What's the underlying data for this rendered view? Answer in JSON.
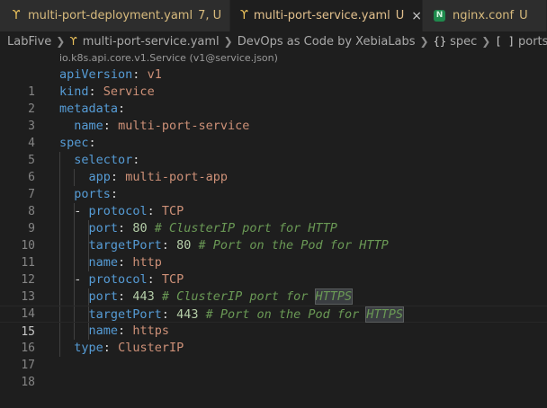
{
  "tabs": [
    {
      "label": "multi-port-deployment.yaml",
      "badge": "7, U",
      "icon": "yaml-icon",
      "active": false
    },
    {
      "label": "multi-port-service.yaml",
      "badge": "U",
      "icon": "yaml-icon",
      "active": true,
      "close": "×"
    },
    {
      "label": "nginx.conf",
      "badge": "U",
      "icon": "nginx-icon",
      "icon_text": "N",
      "active": false
    }
  ],
  "breadcrumb": {
    "folder": "LabFive",
    "file": "multi-port-service.yaml",
    "schema": "DevOps as Code by XebiaLabs",
    "spec_symbol": "{}",
    "spec": "spec",
    "ports_symbol": "[ ]",
    "ports": "ports"
  },
  "codelens": "io.k8s.api.core.v1.Service (v1@service.json)",
  "editor": {
    "current_line": 15,
    "lines": [
      {
        "n": "1"
      },
      {
        "n": "2"
      },
      {
        "n": "3"
      },
      {
        "n": "4"
      },
      {
        "n": "5"
      },
      {
        "n": "6"
      },
      {
        "n": "7"
      },
      {
        "n": "8"
      },
      {
        "n": "9"
      },
      {
        "n": "10"
      },
      {
        "n": "11"
      },
      {
        "n": "12"
      },
      {
        "n": "13"
      },
      {
        "n": "14"
      },
      {
        "n": "15"
      },
      {
        "n": "16"
      },
      {
        "n": "17"
      },
      {
        "n": "18"
      }
    ],
    "tokens": {
      "l1_key": "apiVersion",
      "l1_colon": ":",
      "l1_val": "v1",
      "l2_key": "kind",
      "l2_colon": ":",
      "l2_val": "Service",
      "l3_key": "metadata",
      "l3_colon": ":",
      "l4_key": "name",
      "l4_colon": ":",
      "l4_val": "multi-port-service",
      "l5_key": "spec",
      "l5_colon": ":",
      "l6_key": "selector",
      "l6_colon": ":",
      "l7_key": "app",
      "l7_colon": ":",
      "l7_val": "multi-port-app",
      "l8_key": "ports",
      "l8_colon": ":",
      "l9_dash": "-",
      "l9_key": "protocol",
      "l9_colon": ":",
      "l9_val": "TCP",
      "l10_key": "port",
      "l10_colon": ":",
      "l10_val": "80",
      "l10_comment": "# ClusterIP port for HTTP",
      "l11_key": "targetPort",
      "l11_colon": ":",
      "l11_val": "80",
      "l11_comment": "# Port on the Pod for HTTP",
      "l12_key": "name",
      "l12_colon": ":",
      "l12_val": "http",
      "l13_dash": "-",
      "l13_key": "protocol",
      "l13_colon": ":",
      "l13_val": "TCP",
      "l14_key": "port",
      "l14_colon": ":",
      "l14_val": "443",
      "l14_comment": "# ClusterIP port for ",
      "l14_hl": "HTTPS",
      "l15_key": "targetPort",
      "l15_colon": ":",
      "l15_val": "443",
      "l15_comment": "# Port on the Pod for ",
      "l15_hl": "HTTPS",
      "l16_key": "name",
      "l16_colon": ":",
      "l16_val": "https",
      "l17_key": "type",
      "l17_colon": ":",
      "l17_val": "ClusterIP"
    }
  },
  "colors": {
    "background": "#1e1e1e",
    "key": "#569cd6",
    "string": "#ce9178",
    "number": "#b5cea8",
    "comment": "#6a9955",
    "modified_tab": "#e2c08d"
  }
}
